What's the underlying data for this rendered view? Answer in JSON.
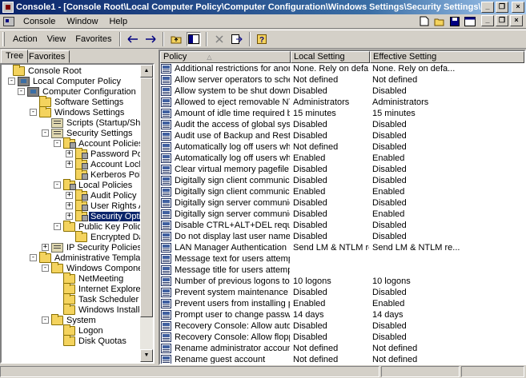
{
  "window": {
    "title": "Console1 - [Console Root\\Local Computer Policy\\Computer Configuration\\Windows Settings\\Security Settings\\Local Policies\\Se...",
    "minimize": "_",
    "restore": "❐",
    "close": "×"
  },
  "menubar": {
    "items": [
      "Console",
      "Window",
      "Help"
    ],
    "mnemonics": [
      "C",
      "W",
      "H"
    ]
  },
  "toolbar": {
    "menus": [
      "Action",
      "View",
      "Favorites"
    ]
  },
  "tree": {
    "tabs": [
      "Tree",
      "Favorites"
    ],
    "items": [
      {
        "label": "Console Root",
        "icon": "folder-icon",
        "expander": ""
      },
      {
        "label": "Local Computer Policy",
        "icon": "computer-icon",
        "expander": "-"
      },
      {
        "label": "Computer Configuration",
        "icon": "computer-icon",
        "expander": "-"
      },
      {
        "label": "Software Settings",
        "icon": "folder-icon",
        "expander": ""
      },
      {
        "label": "Windows Settings",
        "icon": "folder-icon",
        "expander": "-"
      },
      {
        "label": "Scripts (Startup/Shutdown)",
        "icon": "policy-icon",
        "expander": ""
      },
      {
        "label": "Security Settings",
        "icon": "policy-icon",
        "expander": "-"
      },
      {
        "label": "Account Policies",
        "icon": "lock-folder-icon",
        "expander": "-"
      },
      {
        "label": "Password Policy",
        "icon": "lock-folder-icon",
        "expander": "+"
      },
      {
        "label": "Account Lockout",
        "icon": "lock-folder-icon",
        "expander": "+"
      },
      {
        "label": "Kerberos Policy",
        "icon": "lock-folder-icon",
        "expander": ""
      },
      {
        "label": "Local Policies",
        "icon": "lock-folder-icon",
        "expander": "-"
      },
      {
        "label": "Audit Policy",
        "icon": "lock-folder-icon",
        "expander": "+"
      },
      {
        "label": "User Rights Assig",
        "icon": "lock-folder-icon",
        "expander": "+"
      },
      {
        "label": "Security Options",
        "icon": "lock-folder-icon",
        "expander": "+"
      },
      {
        "label": "Public Key Policies",
        "icon": "folder-icon",
        "expander": "-"
      },
      {
        "label": "Encrypted Data R",
        "icon": "folder-icon",
        "expander": ""
      },
      {
        "label": "IP Security Policies or",
        "icon": "policy-icon",
        "expander": "+"
      },
      {
        "label": "Administrative Templates",
        "icon": "folder-icon",
        "expander": "-"
      },
      {
        "label": "Windows Components",
        "icon": "folder-icon",
        "expander": "-"
      },
      {
        "label": "NetMeeting",
        "icon": "folder-icon",
        "expander": ""
      },
      {
        "label": "Internet Explorer",
        "icon": "folder-icon",
        "expander": ""
      },
      {
        "label": "Task Scheduler",
        "icon": "folder-icon",
        "expander": ""
      },
      {
        "label": "Windows Installer",
        "icon": "folder-icon",
        "expander": ""
      },
      {
        "label": "System",
        "icon": "folder-icon",
        "expander": "-"
      },
      {
        "label": "Logon",
        "icon": "folder-icon",
        "expander": ""
      },
      {
        "label": "Disk Quotas",
        "icon": "folder-icon",
        "expander": ""
      }
    ],
    "selected_index": 14
  },
  "list": {
    "columns": [
      "Policy",
      "Local Setting",
      "Effective Setting"
    ],
    "sort_indicator": "△",
    "rows": [
      [
        "Additional restrictions for anonym...",
        "None. Rely on defa...",
        "None. Rely on defa..."
      ],
      [
        "Allow server operators to schedul...",
        "Not defined",
        "Not defined"
      ],
      [
        "Allow system to be shut down with...",
        "Disabled",
        "Disabled"
      ],
      [
        "Allowed to eject removable NTFS ...",
        "Administrators",
        "Administrators"
      ],
      [
        "Amount of idle time required befor...",
        "15 minutes",
        "15 minutes"
      ],
      [
        "Audit the access of global system ...",
        "Disabled",
        "Disabled"
      ],
      [
        "Audit use of Backup and Restore p...",
        "Disabled",
        "Disabled"
      ],
      [
        "Automatically log off users when l...",
        "Not defined",
        "Disabled"
      ],
      [
        "Automatically log off users when l...",
        "Enabled",
        "Enabled"
      ],
      [
        "Clear virtual memory pagefile whe...",
        "Disabled",
        "Disabled"
      ],
      [
        "Digitally sign client communication ...",
        "Disabled",
        "Disabled"
      ],
      [
        "Digitally sign client communication ...",
        "Enabled",
        "Enabled"
      ],
      [
        "Digitally sign server communication...",
        "Disabled",
        "Disabled"
      ],
      [
        "Digitally sign server communication...",
        "Disabled",
        "Enabled"
      ],
      [
        "Disable CTRL+ALT+DEL requireme...",
        "Disabled",
        "Disabled"
      ],
      [
        "Do not display last user name in lo...",
        "Disabled",
        "Disabled"
      ],
      [
        "LAN Manager Authentication Level",
        "Send LM & NTLM re...",
        "Send LM & NTLM re..."
      ],
      [
        "Message text for users attempting...",
        "",
        ""
      ],
      [
        "Message title for users attempting...",
        "",
        ""
      ],
      [
        "Number of previous logons to cach...",
        "10 logons",
        "10 logons"
      ],
      [
        "Prevent system maintenance of co...",
        "Disabled",
        "Disabled"
      ],
      [
        "Prevent users from installing print...",
        "Enabled",
        "Enabled"
      ],
      [
        "Prompt user to change password ...",
        "14 days",
        "14 days"
      ],
      [
        "Recovery Console: Allow automati...",
        "Disabled",
        "Disabled"
      ],
      [
        "Recovery Console: Allow floppy co...",
        "Disabled",
        "Disabled"
      ],
      [
        "Rename administrator account",
        "Not defined",
        "Not defined"
      ],
      [
        "Rename guest account",
        "Not defined",
        "Not defined"
      ]
    ]
  }
}
